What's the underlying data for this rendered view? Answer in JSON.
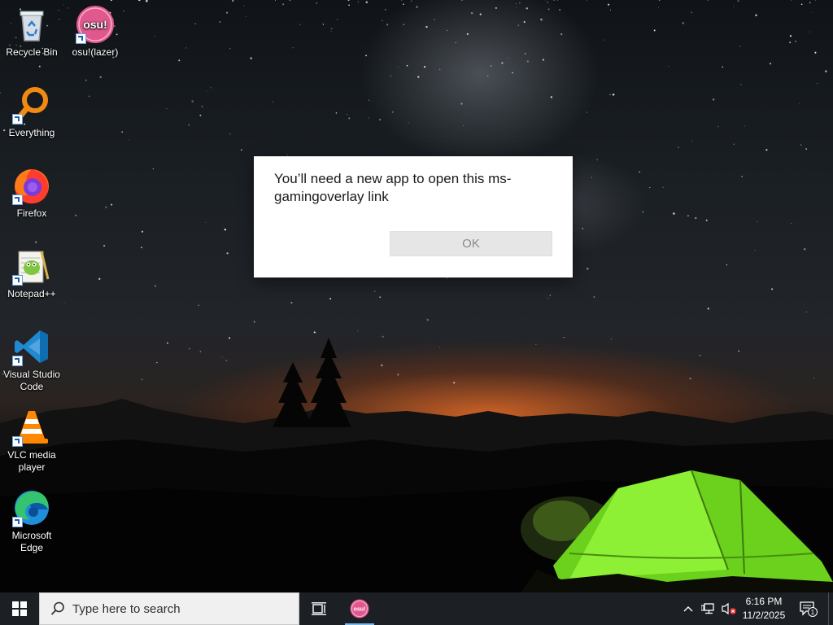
{
  "desktop": {
    "icons": [
      {
        "label": "Recycle Bin",
        "icon": "recycle-bin-icon"
      },
      {
        "label": "osu!(lazer)",
        "icon": "osu-icon",
        "shortcut": true
      },
      {
        "label": "Everything",
        "icon": "everything-search-icon",
        "shortcut": true
      },
      {
        "label": "Firefox",
        "icon": "firefox-icon",
        "shortcut": true
      },
      {
        "label": "Notepad++",
        "icon": "notepad-plus-plus-icon",
        "shortcut": true
      },
      {
        "label": "Visual Studio Code",
        "icon": "vscode-icon",
        "shortcut": true
      },
      {
        "label": "VLC media player",
        "icon": "vlc-icon",
        "shortcut": true
      },
      {
        "label": "Microsoft Edge",
        "icon": "edge-icon",
        "shortcut": true
      }
    ],
    "osu_badge_text": "osu!"
  },
  "dialog": {
    "message": "You’ll need a new app to open this ms-gamingoverlay link",
    "ok_label": "OK"
  },
  "taskbar": {
    "search_placeholder": "Type here to search",
    "pinned_app": "osu!",
    "tray": {
      "time": "6:16 PM",
      "date": "11/2/2025",
      "notification_count": "1"
    }
  },
  "colors": {
    "taskbar_bg": "#1c2024",
    "dialog_bg": "#ffffff",
    "ok_button_bg": "#e6e6e6",
    "osu_pink": "#e0588e",
    "accent": "#76b9ed"
  }
}
